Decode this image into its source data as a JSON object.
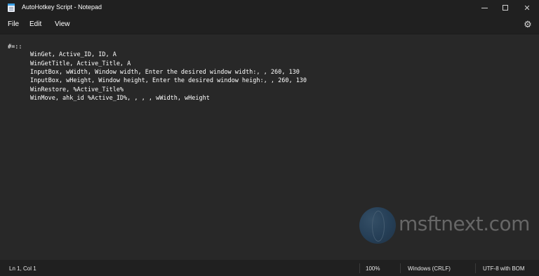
{
  "window": {
    "title": "AutoHotkey Script - Notepad",
    "controls": {
      "minimize": "minimize-icon",
      "maximize": "maximize-icon",
      "close": "✕"
    }
  },
  "menu": {
    "items": [
      "File",
      "Edit",
      "View"
    ],
    "settings_icon": "⚙"
  },
  "editor": {
    "lines": [
      "#=::",
      "WinGet, Active_ID, ID, A",
      "WinGetTitle, Active_Title, A",
      "InputBox, wWidth, Window width, Enter the desired window width:, , 260, 130",
      "InputBox, wHeight, Window height, Enter the desired window heigh:, , 260, 130",
      "WinRestore, %Active_Title%",
      "WinMove, ahk_id %Active_ID%, , , , wWidth, wHeight"
    ]
  },
  "watermark": {
    "text": "msftnext.com",
    "icon": "globe-icon"
  },
  "status": {
    "position": "Ln 1, Col 1",
    "zoom": "100%",
    "line_ending": "Windows (CRLF)",
    "encoding": "UTF-8 with BOM"
  }
}
